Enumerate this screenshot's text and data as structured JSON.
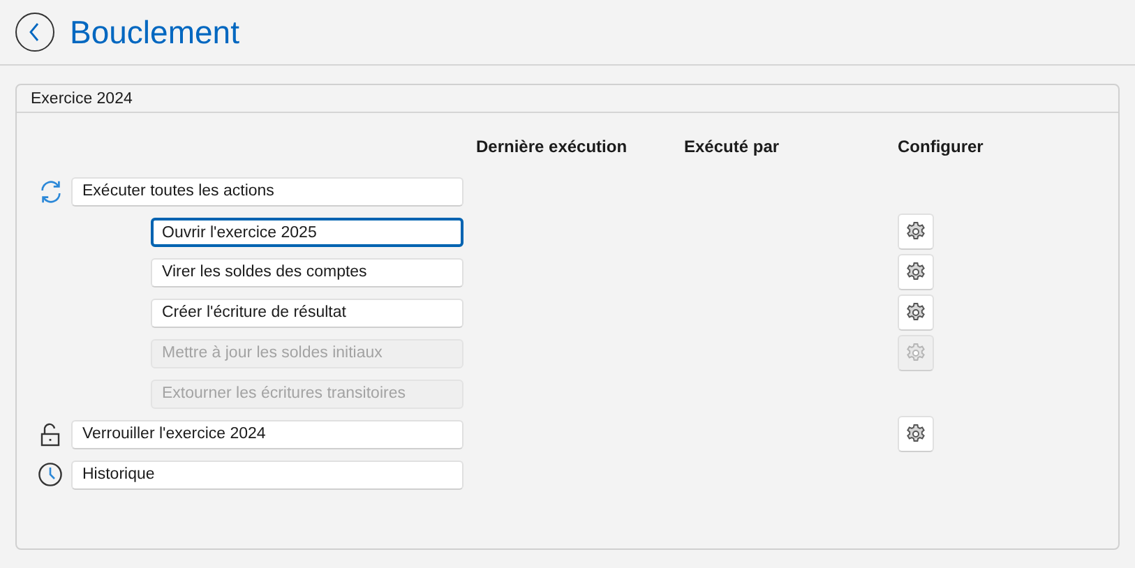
{
  "header": {
    "title": "Bouclement"
  },
  "group": {
    "title": "Exercice 2024"
  },
  "columns": [
    "Dernière exécution",
    "Exécuté par",
    "Configurer"
  ],
  "actions": [
    {
      "kind": "run-all",
      "label": "Exécuter toutes les actions",
      "disabled": false,
      "focused": false,
      "configurable": false
    },
    {
      "kind": "step",
      "label": "Ouvrir l'exercice 2025",
      "disabled": false,
      "focused": true,
      "configurable": true
    },
    {
      "kind": "step",
      "label": "Virer les soldes des comptes",
      "disabled": false,
      "focused": false,
      "configurable": true
    },
    {
      "kind": "step",
      "label": "Créer l'écriture de résultat",
      "disabled": false,
      "focused": false,
      "configurable": true
    },
    {
      "kind": "step",
      "label": "Mettre à jour les soldes initiaux",
      "disabled": true,
      "focused": false,
      "configurable": true
    },
    {
      "kind": "step",
      "label": "Extourner les écritures transitoires",
      "disabled": true,
      "focused": false,
      "configurable": false
    },
    {
      "kind": "lock",
      "label": "Verrouiller l'exercice 2024",
      "disabled": false,
      "focused": false,
      "configurable": true
    },
    {
      "kind": "history",
      "label": "Historique",
      "disabled": false,
      "focused": false,
      "configurable": false
    }
  ]
}
